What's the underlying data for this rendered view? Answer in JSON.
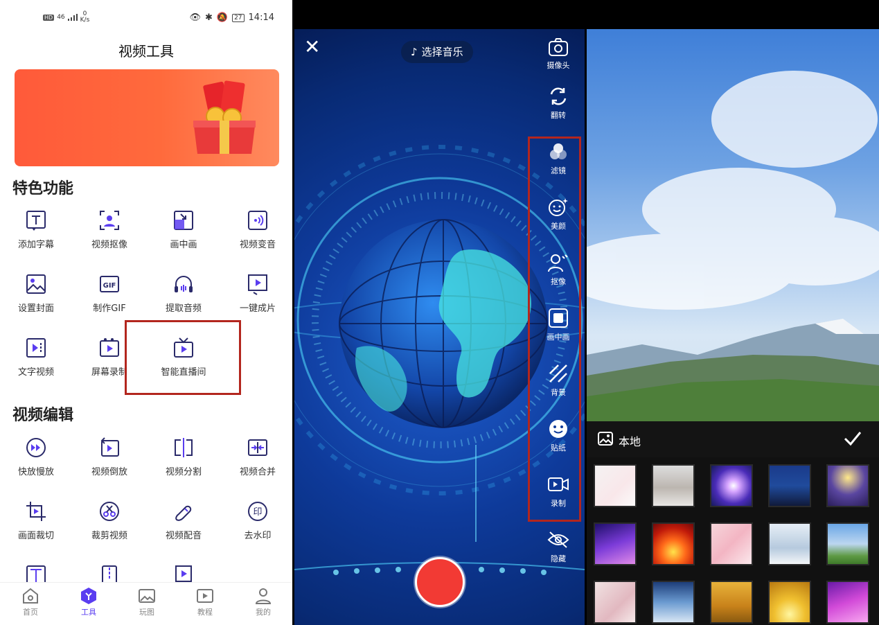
{
  "panel1": {
    "status": {
      "left_hd": "HD",
      "left_net": "46",
      "speed_value": "0",
      "speed_unit": "K/s",
      "battery": "27",
      "time": "14:14"
    },
    "title": "视频工具",
    "section_featured": "特色功能",
    "featured": [
      {
        "label": "添加字幕",
        "icon": "subtitle-icon"
      },
      {
        "label": "视频抠像",
        "icon": "portrait-cutout-icon"
      },
      {
        "label": "画中画",
        "icon": "picture-in-picture-icon"
      },
      {
        "label": "视频变音",
        "icon": "voice-change-icon"
      },
      {
        "label": "设置封面",
        "icon": "cover-image-icon"
      },
      {
        "label": "制作GIF",
        "icon": "gif-icon"
      },
      {
        "label": "提取音频",
        "icon": "headphones-icon"
      },
      {
        "label": "一键成片",
        "icon": "one-click-video-icon"
      },
      {
        "label": "文字视频",
        "icon": "text-video-icon"
      },
      {
        "label": "屏幕录制",
        "icon": "screen-record-icon"
      },
      {
        "label": "智能直播间",
        "icon": "live-tv-icon"
      }
    ],
    "section_edit": "视频编辑",
    "edit": [
      {
        "label": "快放慢放",
        "icon": "speed-icon"
      },
      {
        "label": "视频倒放",
        "icon": "reverse-icon"
      },
      {
        "label": "视频分割",
        "icon": "split-icon"
      },
      {
        "label": "视频合并",
        "icon": "merge-icon"
      },
      {
        "label": "画面裁切",
        "icon": "crop-icon"
      },
      {
        "label": "裁剪视频",
        "icon": "trim-icon"
      },
      {
        "label": "视频配音",
        "icon": "dubbing-icon"
      },
      {
        "label": "去水印",
        "icon": "watermark-remove-icon"
      }
    ],
    "tabs": [
      {
        "label": "首页",
        "icon": "home-icon"
      },
      {
        "label": "工具",
        "icon": "tools-icon",
        "active": true
      },
      {
        "label": "玩图",
        "icon": "image-icon"
      },
      {
        "label": "教程",
        "icon": "tutorial-icon"
      },
      {
        "label": "我的",
        "icon": "profile-icon"
      }
    ]
  },
  "panel2": {
    "music_label": "选择音乐",
    "side": [
      {
        "label": "摄像头",
        "icon": "camera-icon"
      },
      {
        "label": "翻转",
        "icon": "flip-icon"
      },
      {
        "label": "滤镜",
        "icon": "filter-icon"
      },
      {
        "label": "美颜",
        "icon": "beauty-icon"
      },
      {
        "label": "抠像",
        "icon": "cutout-icon"
      },
      {
        "label": "画中画",
        "icon": "pip-icon"
      },
      {
        "label": "背景",
        "icon": "background-icon"
      },
      {
        "label": "贴纸",
        "icon": "sticker-icon"
      },
      {
        "label": "录制",
        "icon": "record-icon"
      },
      {
        "label": "隐藏",
        "icon": "hide-icon"
      }
    ]
  },
  "panel3": {
    "local_label": "本地"
  },
  "colors": {
    "accent": "#5a3df0",
    "highlight": "#b3261e",
    "record": "#f23a34"
  }
}
